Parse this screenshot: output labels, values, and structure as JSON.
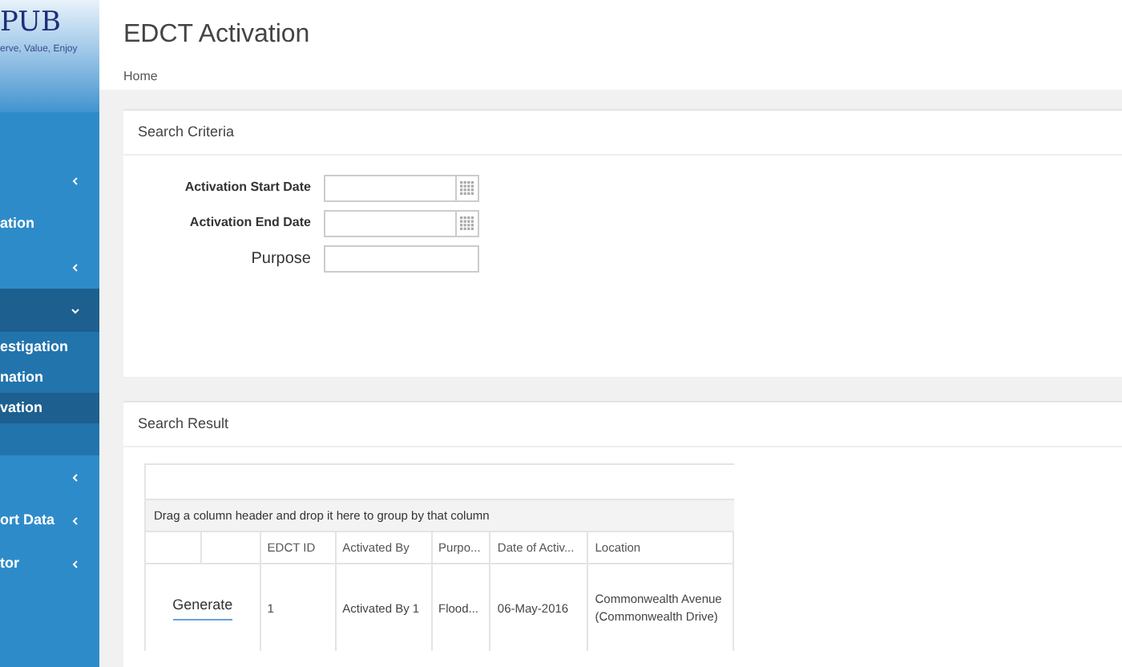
{
  "logo": {
    "name": "PUB",
    "tagline": "erve, Value, Enjoy"
  },
  "sidebar": {
    "items": [
      {
        "expanded": false
      },
      {
        "label": "ation"
      },
      {
        "expanded": false
      },
      {
        "expanded": true,
        "children": [
          {
            "label": "estigation",
            "selected": false
          },
          {
            "label": "nation",
            "selected": false
          },
          {
            "label": "vation",
            "selected": true
          }
        ]
      },
      {
        "expanded": false
      },
      {
        "label": "ort Data",
        "expanded": false
      },
      {
        "label": "tor",
        "expanded": false
      }
    ]
  },
  "page": {
    "title": "EDCT Activation",
    "breadcrumb": "Home"
  },
  "search_criteria": {
    "title": "Search Criteria",
    "fields": [
      {
        "kind": "date",
        "label": "Activation Start Date"
      },
      {
        "kind": "date",
        "label": "Activation End Date"
      },
      {
        "kind": "text",
        "label": "Purpose"
      }
    ]
  },
  "search_result": {
    "title": "Search Result",
    "group_hint": "Drag a column header and drop it here to group by that column",
    "columns": [
      "EDCT ID",
      "Activated By",
      "Purpo...",
      "Date of Activ...",
      "Location"
    ],
    "rows": [
      {
        "action": "Generate",
        "cells": [
          "1",
          "Activated By 1",
          "Flood...",
          "06-May-2016",
          "Commonwealth Avenue (Commonwealth Drive)"
        ]
      }
    ]
  }
}
